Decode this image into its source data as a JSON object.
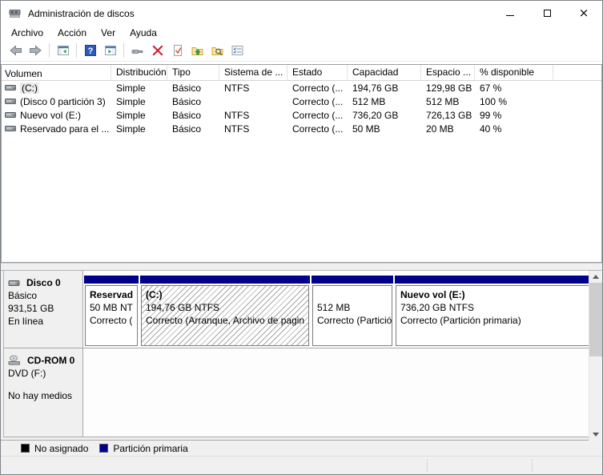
{
  "window": {
    "title": "Administración de discos",
    "controls": [
      "minimize",
      "maximize",
      "close"
    ],
    "maximize_glyph": "",
    "close_glyph": "×"
  },
  "menu": {
    "items": [
      "Archivo",
      "Acción",
      "Ver",
      "Ayuda"
    ]
  },
  "toolbar": {
    "icons": [
      "back",
      "forward",
      "show-console-tree",
      "help",
      "show-action-pane",
      "tools",
      "delete",
      "check-document",
      "folder-up",
      "folder-search",
      "properties-list"
    ]
  },
  "volume_list": {
    "columns": [
      "Volumen",
      "Distribución",
      "Tipo",
      "Sistema de ...",
      "Estado",
      "Capacidad",
      "Espacio ...",
      "% disponible"
    ],
    "rows": [
      {
        "volumen": "(C:)",
        "distribucion": "Simple",
        "tipo": "Básico",
        "sistema": "NTFS",
        "estado": "Correcto (...",
        "capacidad": "194,76 GB",
        "espacio": "129,98 GB",
        "disponible": "67 %"
      },
      {
        "volumen": "(Disco 0 partición 3)",
        "distribucion": "Simple",
        "tipo": "Básico",
        "sistema": "",
        "estado": "Correcto (...",
        "capacidad": "512 MB",
        "espacio": "512 MB",
        "disponible": "100 %"
      },
      {
        "volumen": "Nuevo vol (E:)",
        "distribucion": "Simple",
        "tipo": "Básico",
        "sistema": "NTFS",
        "estado": "Correcto (...",
        "capacidad": "736,20 GB",
        "espacio": "726,13 GB",
        "disponible": "99 %"
      },
      {
        "volumen": "Reservado para el ...",
        "distribucion": "Simple",
        "tipo": "Básico",
        "sistema": "NTFS",
        "estado": "Correcto (...",
        "capacidad": "50 MB",
        "espacio": "20 MB",
        "disponible": "40 %"
      }
    ]
  },
  "disk_pane": {
    "disk0": {
      "name": "Disco 0",
      "type": "Básico",
      "size": "931,51 GB",
      "status": "En línea",
      "partitions": [
        {
          "name": "Reservad",
          "size": "50 MB NT",
          "status": "Correcto ("
        },
        {
          "name": "(C:)",
          "size": "194,76 GB NTFS",
          "status": "Correcto (Arranque, Archivo de pagin"
        },
        {
          "name": "",
          "size": "512 MB",
          "status": "Correcto (Partició"
        },
        {
          "name": "Nuevo vol (E:)",
          "size": "736,20 GB NTFS",
          "status": "Correcto (Partición primaria)"
        }
      ]
    },
    "cdrom": {
      "name": "CD-ROM 0",
      "type": "DVD (F:)",
      "status": "No hay medios"
    }
  },
  "legend": {
    "items": [
      {
        "label": "No asignado",
        "color": "#000000"
      },
      {
        "label": "Partición primaria",
        "color": "#00008b"
      }
    ]
  },
  "colors": {
    "partition_primary_bar": "#00008b"
  }
}
